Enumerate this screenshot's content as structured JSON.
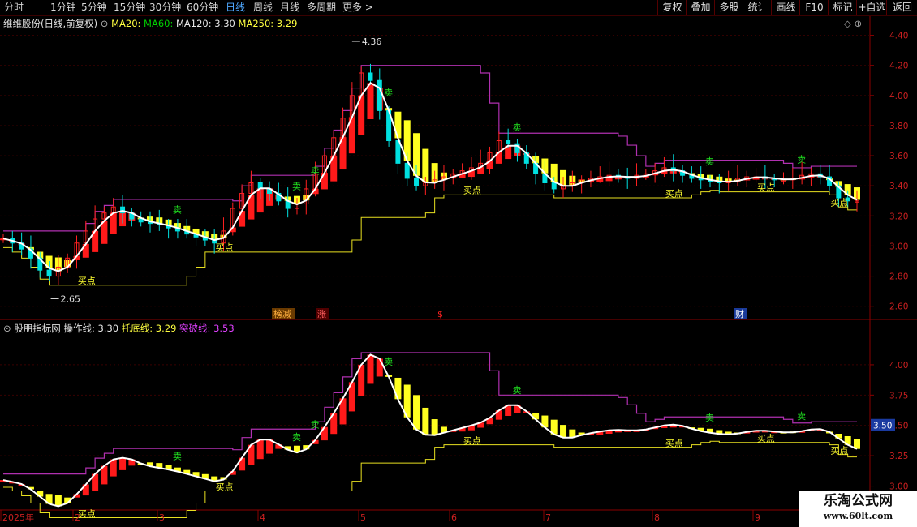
{
  "toolbar": {
    "periods": [
      "分时",
      "1分钟",
      "5分钟",
      "15分钟",
      "30分钟",
      "60分钟",
      "日线",
      "周线",
      "月线",
      "多周期",
      "更多 >"
    ],
    "active_period": "日线",
    "right_buttons": [
      "复权",
      "叠加",
      "多股",
      "统计",
      "画线",
      "F10",
      "标记",
      "+自选",
      "返回"
    ]
  },
  "main_panel": {
    "title": "维维股份(日线,前复权)",
    "ma_labels": [
      "MA20:",
      "MA60:",
      "MA120: 3.30",
      "MA250: 3.29"
    ],
    "ma_colors": [
      "#ffff40",
      "#00d000",
      "#e8e8e8",
      "#ffff40"
    ],
    "high_marker": "4.36",
    "low_marker": "2.65",
    "y_ticks": [
      "4.40",
      "4.20",
      "4.00",
      "3.80",
      "3.60",
      "3.40",
      "3.20",
      "3.00",
      "2.80",
      "2.60"
    ],
    "y_tick_values": [
      4.4,
      4.2,
      4.0,
      3.8,
      3.6,
      3.4,
      3.2,
      3.0,
      2.8,
      2.6
    ],
    "buy_label": "买点",
    "sell_label": "卖",
    "events": [
      {
        "text": "榜减",
        "color": "#ffb040",
        "bg": "#6a3a00"
      },
      {
        "text": "涨",
        "color": "#ff6060",
        "bg": "#500000"
      },
      {
        "text": "$",
        "color": "#ff2020",
        "bg": ""
      },
      {
        "text": "财",
        "color": "#ffffff",
        "bg": "#1a3a9a"
      }
    ]
  },
  "sub_panel": {
    "title": "股朋指标网",
    "labels": [
      "操作线: 3.30",
      "托底线: 3.29",
      "突破线: 3.53"
    ],
    "label_colors": [
      "#e8e8e8",
      "#ffff40",
      "#e040ff"
    ],
    "y_ticks": [
      "4.00",
      "3.75",
      "3.50",
      "3.25",
      "3.00"
    ],
    "y_tick_values": [
      4.0,
      3.75,
      3.5,
      3.25,
      3.0
    ],
    "current_value": "3.50"
  },
  "date_axis": {
    "labels": [
      "2025年",
      "2",
      "3",
      "4",
      "5",
      "6",
      "7",
      "8",
      "9"
    ]
  },
  "watermark": {
    "title": "乐淘公式网",
    "url": "www.60lt.com"
  },
  "colors": {
    "bull": "#ff2020",
    "bear": "#00e0e0",
    "magenta": "#c030c0",
    "yellow": "#ffff20",
    "axis": "#8a0000"
  },
  "chart_data": {
    "type": "candlestick",
    "y_range_main": [
      2.55,
      4.5
    ],
    "y_range_sub": [
      2.85,
      4.2
    ],
    "close": [
      3.05,
      3.02,
      2.98,
      2.92,
      2.84,
      2.8,
      2.86,
      2.92,
      3.02,
      3.1,
      3.18,
      3.22,
      3.26,
      3.22,
      3.18,
      3.16,
      3.15,
      3.14,
      3.12,
      3.1,
      3.08,
      3.06,
      3.04,
      3.02,
      3.1,
      3.25,
      3.35,
      3.42,
      3.38,
      3.35,
      3.3,
      3.25,
      3.28,
      3.38,
      3.48,
      3.6,
      3.72,
      3.85,
      4.0,
      4.15,
      4.1,
      3.9,
      3.7,
      3.55,
      3.45,
      3.4,
      3.42,
      3.44,
      3.46,
      3.48,
      3.5,
      3.52,
      3.55,
      3.62,
      3.7,
      3.68,
      3.62,
      3.55,
      3.48,
      3.42,
      3.38,
      3.4,
      3.42,
      3.44,
      3.45,
      3.46,
      3.47,
      3.46,
      3.45,
      3.47,
      3.48,
      3.5,
      3.52,
      3.5,
      3.47,
      3.45,
      3.44,
      3.43,
      3.42,
      3.43,
      3.45,
      3.46,
      3.46,
      3.45,
      3.44,
      3.44,
      3.45,
      3.47,
      3.48,
      3.46,
      3.4,
      3.32,
      3.3,
      3.3
    ]
  }
}
